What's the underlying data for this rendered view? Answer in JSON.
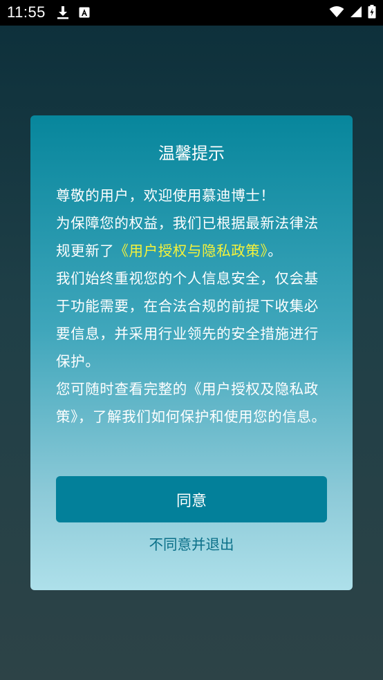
{
  "status_bar": {
    "time": "11:55",
    "left_icons": [
      "download-icon",
      "a-badge-icon"
    ],
    "right_icons": [
      "wifi-icon",
      "signal-icon",
      "battery-icon"
    ]
  },
  "dialog": {
    "title": "温馨提示",
    "greeting": "尊敬的用户，欢迎使用慕迪博士！",
    "para1_before": "为保障您的权益，我们已根据最新法律法规更新了",
    "para1_link": "《用户授权与隐私政策》",
    "para1_after": "。",
    "para2": "我们始终重视您的个人信息安全，仅会基于功能需要，在合法合规的前提下收集必要信息，并采用行业领先的安全措施进行保护。",
    "para3": "您可随时查看完整的《用户授权及隐私政策》，了解我们如何保护和使用您的信息。",
    "agree_label": "同意",
    "decline_label": "不同意并退出"
  },
  "colors": {
    "link": "#f5f23a",
    "agree_button": "#03809a",
    "decline_text": "#0a6f88"
  }
}
